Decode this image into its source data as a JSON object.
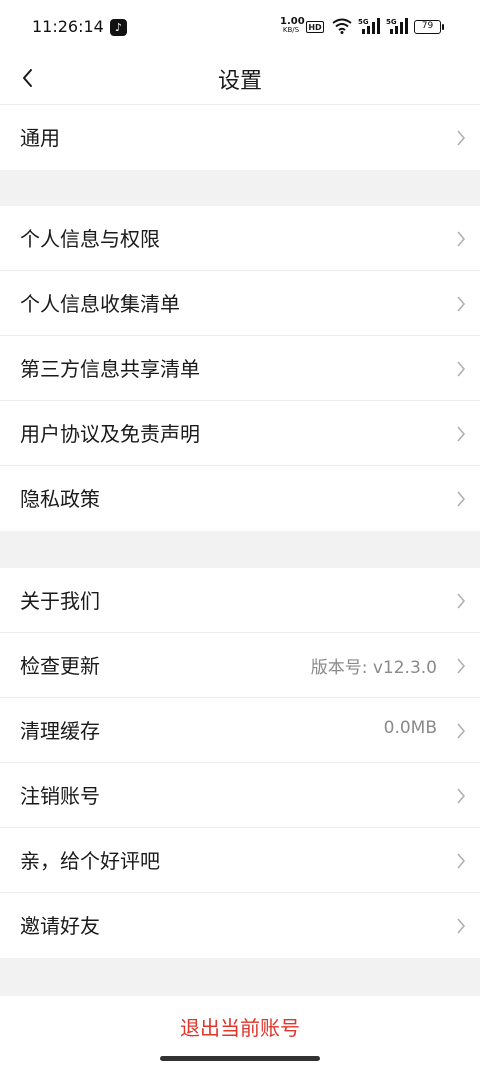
{
  "status_bar": {
    "time": "11:26:14",
    "net_speed_value": "1.00",
    "net_speed_unit": "KB/S",
    "hd_label": "HD",
    "sig1_label": "5G",
    "sig2_label": "5G",
    "battery": "79"
  },
  "header": {
    "title": "设置"
  },
  "groups": [
    {
      "items": [
        {
          "label": "通用"
        }
      ]
    },
    {
      "items": [
        {
          "label": "个人信息与权限"
        },
        {
          "label": "个人信息收集清单"
        },
        {
          "label": "第三方信息共享清单"
        },
        {
          "label": "用户协议及免责声明"
        },
        {
          "label": "隐私政策"
        }
      ]
    },
    {
      "items": [
        {
          "label": "关于我们"
        },
        {
          "label": "检查更新",
          "value": "版本号: v12.3.0"
        },
        {
          "label": "清理缓存",
          "value": "0.0MB"
        },
        {
          "label": "注销账号"
        },
        {
          "label": "亲，给个好评吧"
        },
        {
          "label": "邀请好友"
        }
      ]
    }
  ],
  "logout": {
    "label": "退出当前账号"
  },
  "colors": {
    "accent": "#e0352b",
    "background": "#f2f2f2",
    "secondary_text": "#8a8a8a"
  }
}
